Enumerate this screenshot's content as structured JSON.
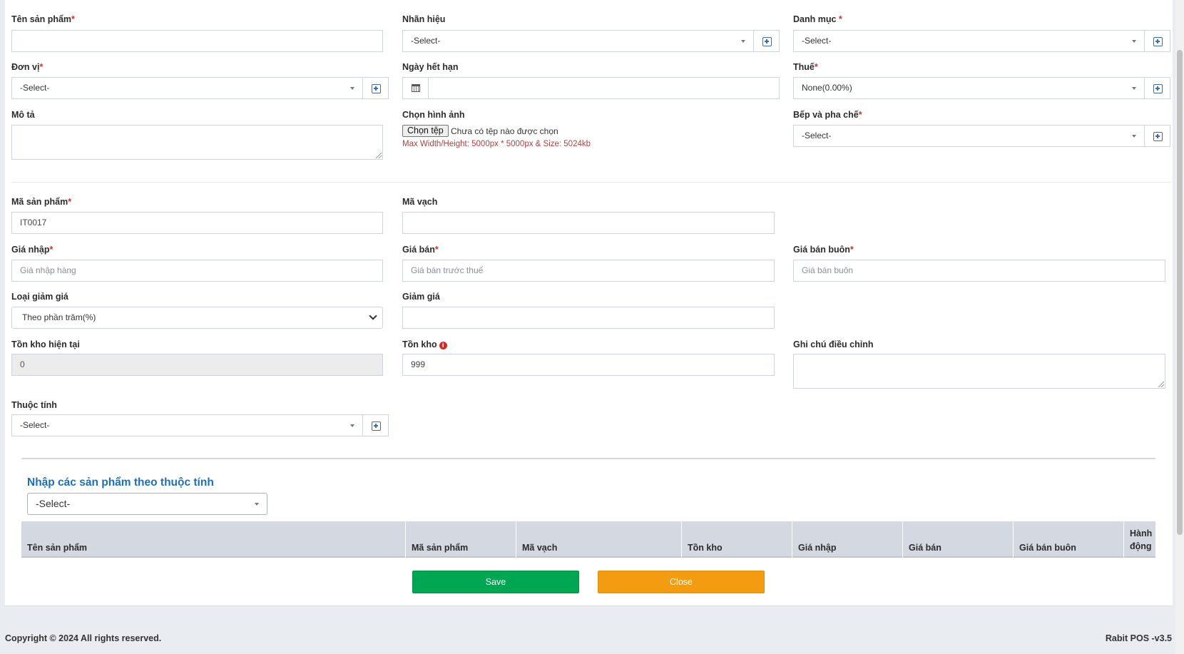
{
  "form": {
    "product_name": {
      "label": "Tên sản phẩm",
      "req": "*",
      "value": ""
    },
    "brand": {
      "label": "Nhãn hiệu",
      "value": "-Select-"
    },
    "category": {
      "label": "Danh mục",
      "req": " *",
      "value": "-Select-"
    },
    "unit": {
      "label": "Đơn vị",
      "req": "*",
      "value": "-Select-"
    },
    "expiry": {
      "label": "Ngày hết hạn",
      "value": ""
    },
    "tax": {
      "label": "Thuế",
      "req": "*",
      "value": "None(0.00%)"
    },
    "description": {
      "label": "Mô tả",
      "value": ""
    },
    "image": {
      "label": "Chọn hình ảnh",
      "button": "Chọn tệp",
      "status": "Chưa có tệp nào được chọn",
      "hint": "Max Width/Height: 5000px * 5000px & Size: 5024kb"
    },
    "kitchen": {
      "label": "Bếp và pha chế",
      "req": "*",
      "value": "-Select-"
    },
    "sku": {
      "label": "Mã sản phẩm",
      "req": "*",
      "value": "IT0017"
    },
    "barcode": {
      "label": "Mã vạch",
      "value": ""
    },
    "purchase_price": {
      "label": "Giá nhập",
      "req": "*",
      "placeholder": "Giá nhập hàng"
    },
    "sale_price": {
      "label": "Giá bán",
      "req": "*",
      "placeholder": "Giá bán trước thuế"
    },
    "wholesale_price": {
      "label": "Giá bán buôn",
      "req": "*",
      "placeholder": "Giá bán buôn"
    },
    "discount_type": {
      "label": "Loại giảm giá",
      "value": "Theo phần trăm(%)"
    },
    "discount": {
      "label": "Giảm giá",
      "value": ""
    },
    "current_stock": {
      "label": "Tồn kho hiện tại",
      "value": "0"
    },
    "stock": {
      "label": "Tồn kho",
      "icon": "info-icon",
      "value": "999"
    },
    "adjust_note": {
      "label": "Ghi chú điều chỉnh",
      "value": ""
    },
    "attribute": {
      "label": "Thuộc tính",
      "value": "-Select-"
    }
  },
  "variants": {
    "title": "Nhập các sản phẩm theo thuộc tính",
    "select_value": "-Select-",
    "columns": [
      "Tên sản phẩm",
      "Mã sản phẩm",
      "Mã vạch",
      "Tồn kho",
      "Giá nhập",
      "Giá bán",
      "Giá bán buôn"
    ],
    "action_col": [
      "Hành",
      "động"
    ]
  },
  "buttons": {
    "save": "Save",
    "close": "Close"
  },
  "footer": {
    "copyright": "Copyright © 2024 All rights reserved.",
    "version": "Rabit POS -v3.5"
  },
  "colors": {
    "save": "#00a651",
    "close": "#f39c12",
    "accent": "#1f6fb5",
    "required": "#c0392b"
  }
}
